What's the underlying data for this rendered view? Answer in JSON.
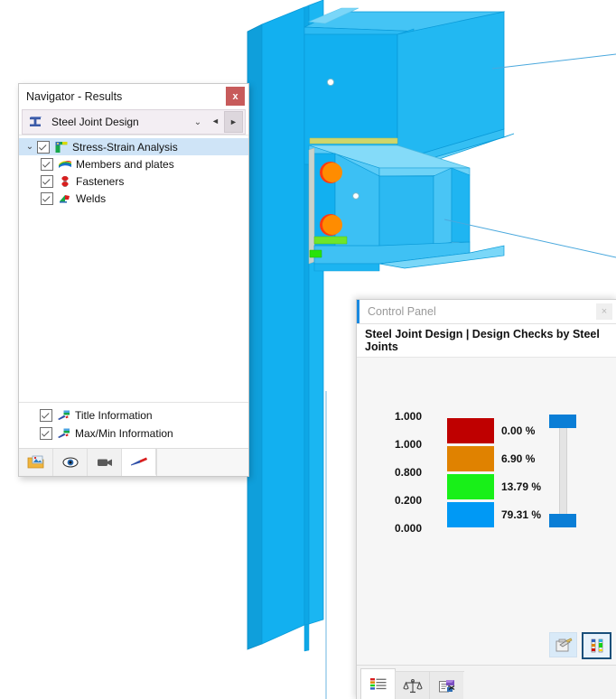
{
  "navigator": {
    "title": "Navigator - Results",
    "close_label": "x",
    "close_icon": "close-icon",
    "combo": {
      "icon": "steel-joint-icon",
      "value": "Steel Joint Design",
      "chevron": "⌄",
      "prev": "◄",
      "next": "►"
    },
    "tree": [
      {
        "label": "Stress-Strain Analysis",
        "icon": "stress-strain-icon",
        "checked": true,
        "selected": true,
        "level": 0,
        "expander": "⌄"
      },
      {
        "label": "Members and plates",
        "icon": "members-plates-icon",
        "checked": true,
        "selected": false,
        "level": 1
      },
      {
        "label": "Fasteners",
        "icon": "fasteners-icon",
        "checked": true,
        "selected": false,
        "level": 1
      },
      {
        "label": "Welds",
        "icon": "welds-icon",
        "checked": true,
        "selected": false,
        "level": 1
      }
    ],
    "bottom_items": [
      {
        "label": "Title Information",
        "icon": "title-information-icon",
        "checked": true
      },
      {
        "label": "Max/Min Information",
        "icon": "maxmin-information-icon",
        "checked": true
      }
    ],
    "toolbar": [
      {
        "name": "render-results-icon",
        "active": false
      },
      {
        "name": "visibility-eye-icon",
        "active": false
      },
      {
        "name": "video-camera-icon",
        "active": false
      },
      {
        "name": "deformation-arrow-icon",
        "active": true
      }
    ]
  },
  "control_panel": {
    "title": "Control Panel",
    "close_label": "×",
    "close_icon": "close-icon",
    "header": "Steel Joint Design | Design Checks by Steel Joints",
    "legend": {
      "scale_values": [
        "1.000",
        "1.000",
        "0.800",
        "0.200",
        "0.000"
      ],
      "bands": [
        {
          "color": "#bf0000",
          "percent": "0.00 %"
        },
        {
          "color": "#e08200",
          "percent": "6.90 %"
        },
        {
          "color": "#18f018",
          "percent": "13.79 %"
        },
        {
          "color": "#0099f5",
          "percent": "79.31 %"
        }
      ],
      "slider_color": "#0a7ed6"
    },
    "tools": [
      {
        "name": "edit-colors-icon",
        "selected": false
      },
      {
        "name": "color-scale-icon",
        "selected": true
      }
    ],
    "tabs": [
      {
        "name": "tab-color-scale",
        "active": true
      },
      {
        "name": "tab-factors-scale",
        "active": false
      },
      {
        "name": "tab-display-properties",
        "active": false
      }
    ]
  },
  "viewport": {
    "model_name": "steel-joint-3d-model",
    "colors": {
      "member_blue": "#12b0f0",
      "member_blue_light": "#5ecdf7",
      "member_blue_dark": "#0a9ad8",
      "fastener_orange": "#ff8c00",
      "fastener_red": "#ff3b10",
      "weld_green": "#55e515",
      "leader_line": "#4aa8dd"
    }
  }
}
